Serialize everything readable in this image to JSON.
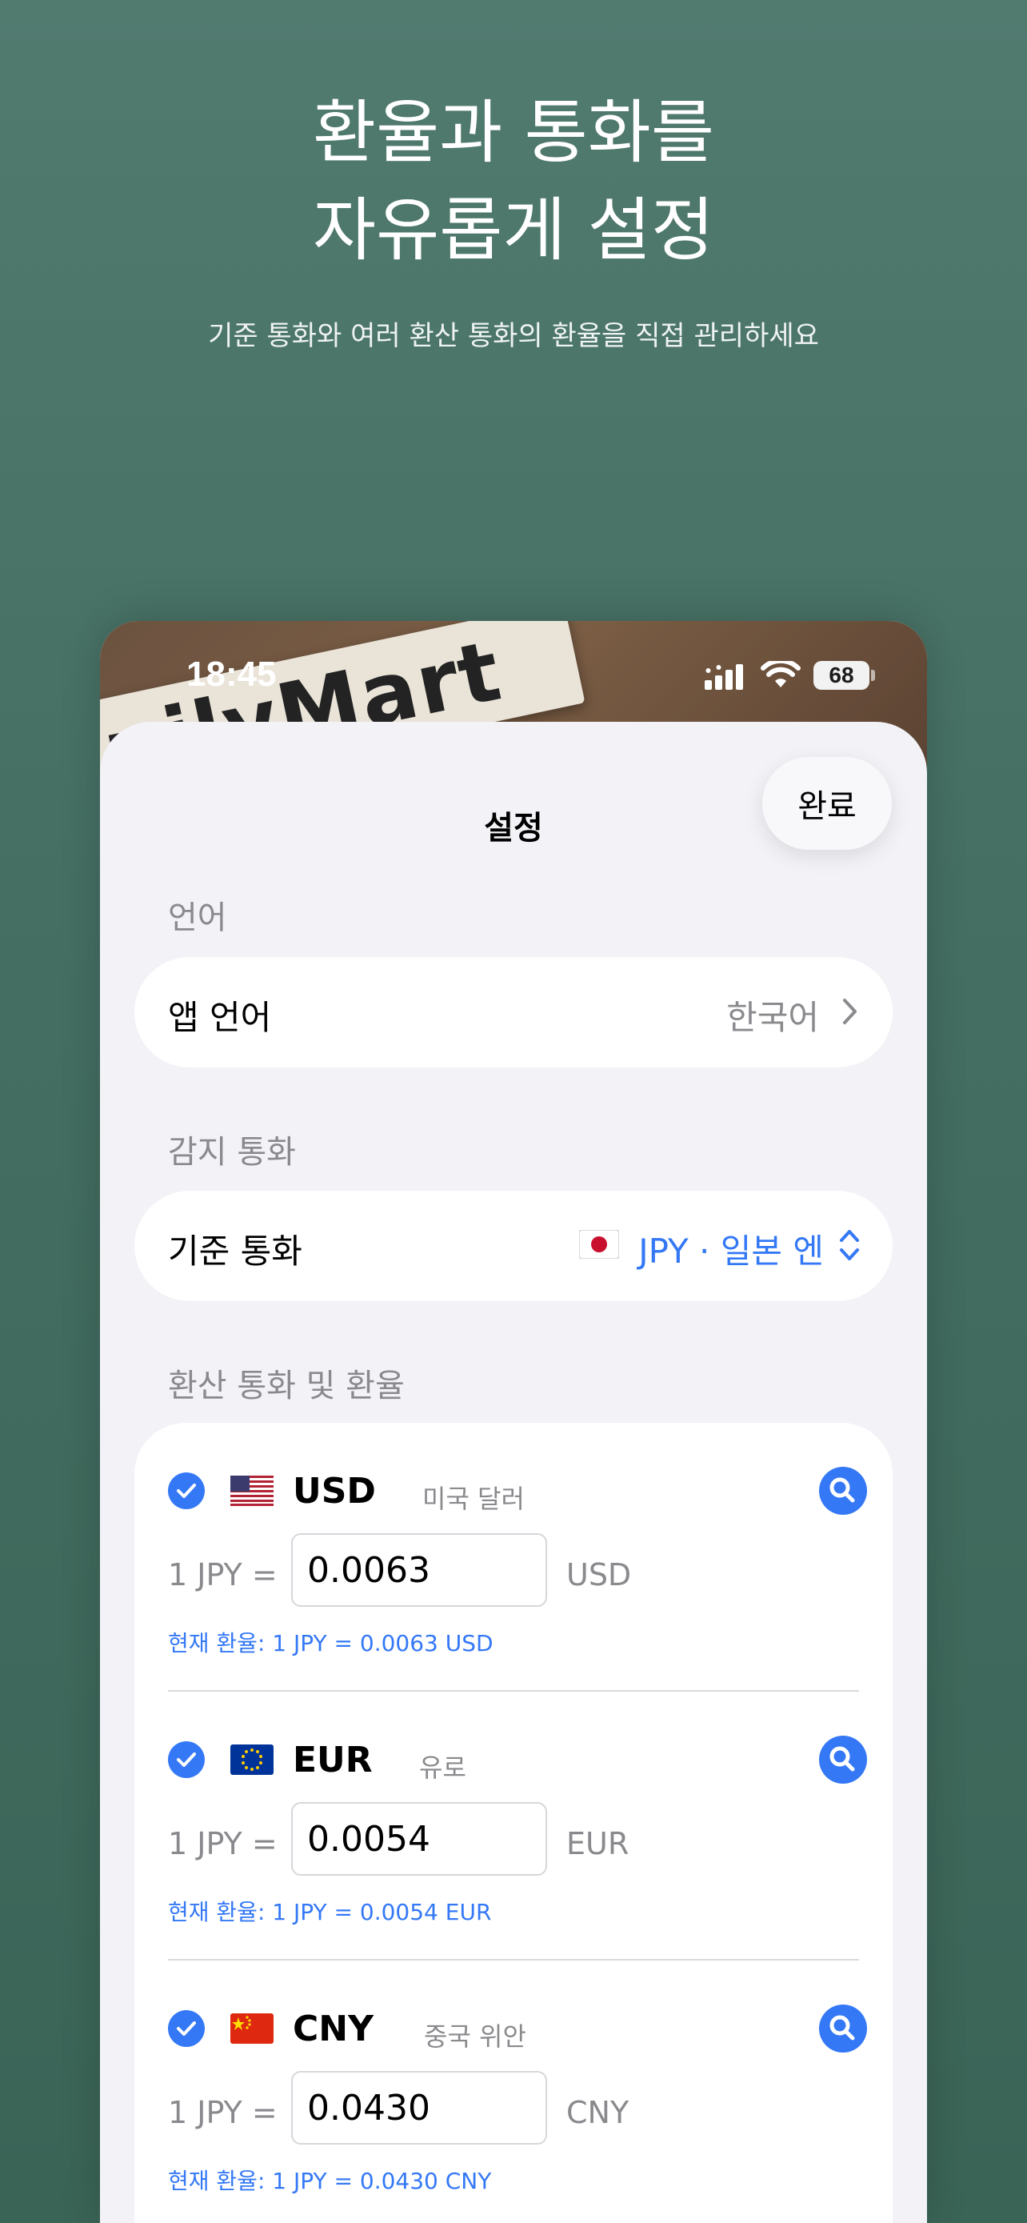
{
  "promo": {
    "title_line1": "환율과 통화를",
    "title_line2": "자유롭게 설정",
    "subtitle": "기준 통화와 여러 환산 통화의 환율을 직접 관리하세요"
  },
  "status_bar": {
    "time": "18:45",
    "battery": "68"
  },
  "wallpaper_text": "pilyMart",
  "sheet": {
    "title": "설정",
    "done_label": "완료"
  },
  "language_section": {
    "header": "언어",
    "row_label": "앱 언어",
    "row_value": "한국어"
  },
  "detect_section": {
    "header": "감지 통화",
    "row_label": "기준 통화",
    "row_value": "JPY · 일본 엔",
    "flag_icon": "japan-flag-icon"
  },
  "conversion_section": {
    "header": "환산 통화 및 환율",
    "items": [
      {
        "code": "USD",
        "name": "미국 달러",
        "prefix": "1 JPY =",
        "rate": "0.0063",
        "unit": "USD",
        "current": "현재 환율: 1 JPY = 0.0063 USD",
        "checked": true,
        "flag_icon": "us-flag-icon"
      },
      {
        "code": "EUR",
        "name": "유로",
        "prefix": "1 JPY =",
        "rate": "0.0054",
        "unit": "EUR",
        "current": "현재 환율: 1 JPY = 0.0054 EUR",
        "checked": true,
        "flag_icon": "eu-flag-icon"
      },
      {
        "code": "CNY",
        "name": "중국 위안",
        "prefix": "1 JPY =",
        "rate": "0.0430",
        "unit": "CNY",
        "current": "현재 환율: 1 JPY = 0.0430 CNY",
        "checked": true,
        "flag_icon": "china-flag-icon"
      }
    ]
  },
  "colors": {
    "accent": "#3478f6",
    "background": "#f2f2f7",
    "promo_bg": "#4a7468"
  }
}
